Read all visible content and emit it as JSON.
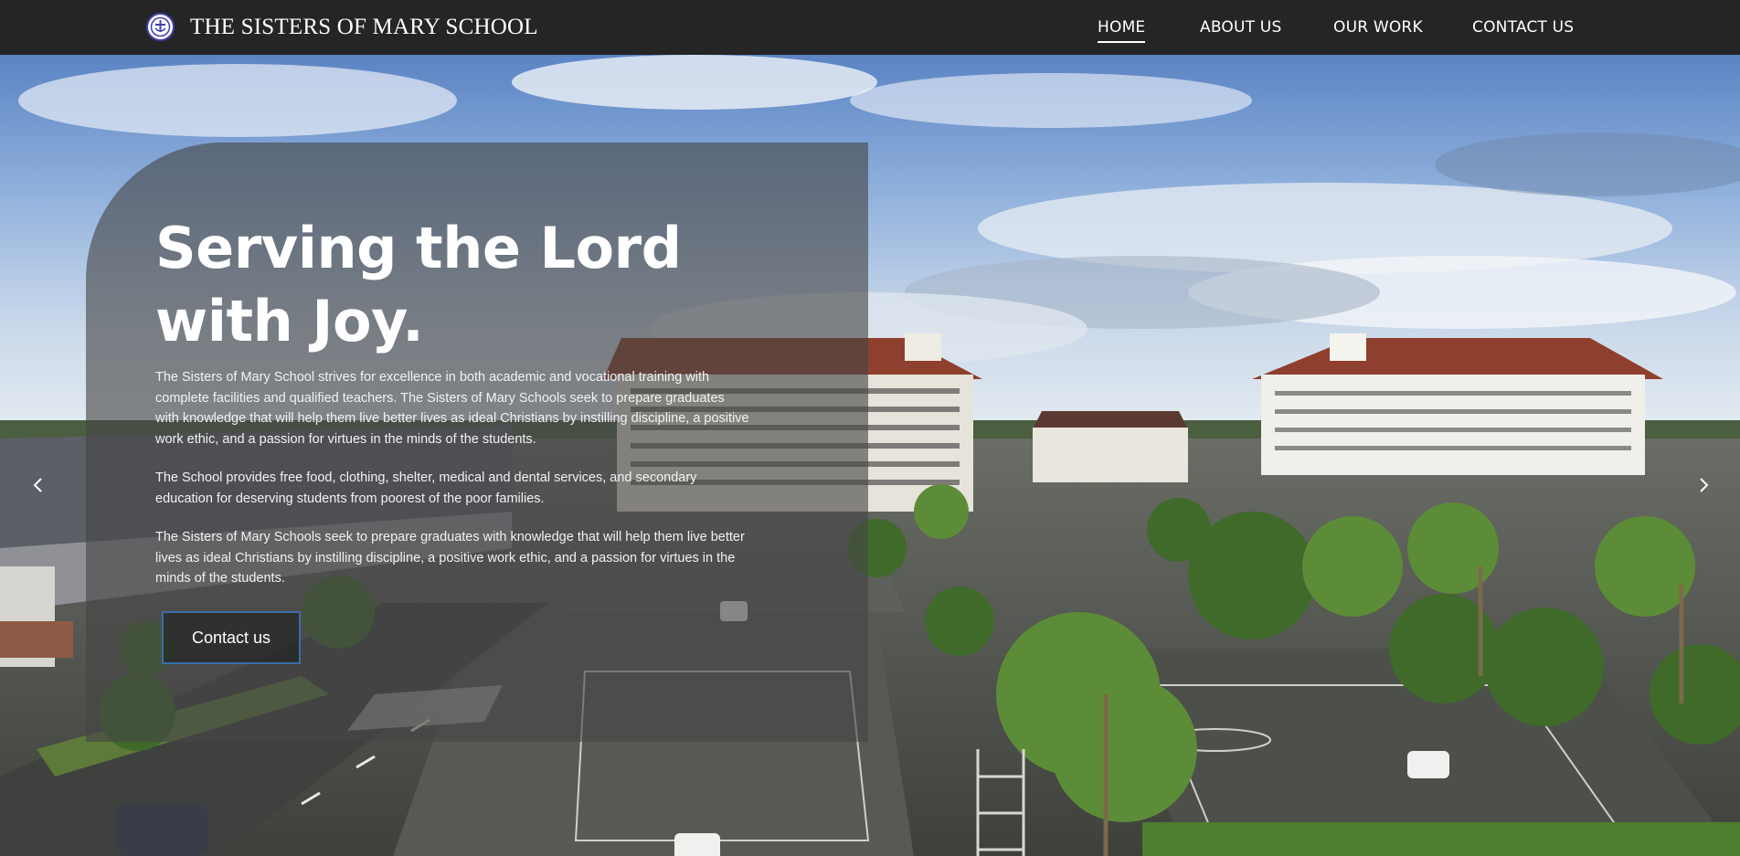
{
  "header": {
    "site_title": "THE SISTERS OF MARY SCHOOL",
    "logo_icon": "school-crest-icon"
  },
  "nav": {
    "items": [
      {
        "label": "HOME",
        "active": true
      },
      {
        "label": "ABOUT US",
        "active": false
      },
      {
        "label": "OUR WORK",
        "active": false
      },
      {
        "label": "CONTACT US",
        "active": false
      }
    ]
  },
  "hero": {
    "headline_line1": "Serving the Lord",
    "headline_line2": "with Joy.",
    "paragraphs": [
      "The Sisters of Mary School strives for excellence in both academic and vocational training with complete facilities and qualified teachers. The Sisters of Mary Schools seek to prepare graduates with knowledge that will help them live better lives as ideal Christians by instilling discipline, a positive work ethic, and a passion for virtues in the minds of the students.",
      "The School provides free food, clothing, shelter, medical and dental services, and secondary education for deserving students from poorest of the poor families.",
      "The Sisters of Mary Schools seek to prepare graduates with knowledge that will help them live better lives as ideal Christians by instilling discipline, a positive work ethic, and a passion for virtues in the minds of the students."
    ],
    "cta_label": "Contact us",
    "prev_icon": "chevron-left-icon",
    "next_icon": "chevron-right-icon"
  },
  "colors": {
    "header_bg": "#252525",
    "cta_border": "#3b6ea8",
    "overlay": "rgba(70,70,70,0.62)"
  }
}
